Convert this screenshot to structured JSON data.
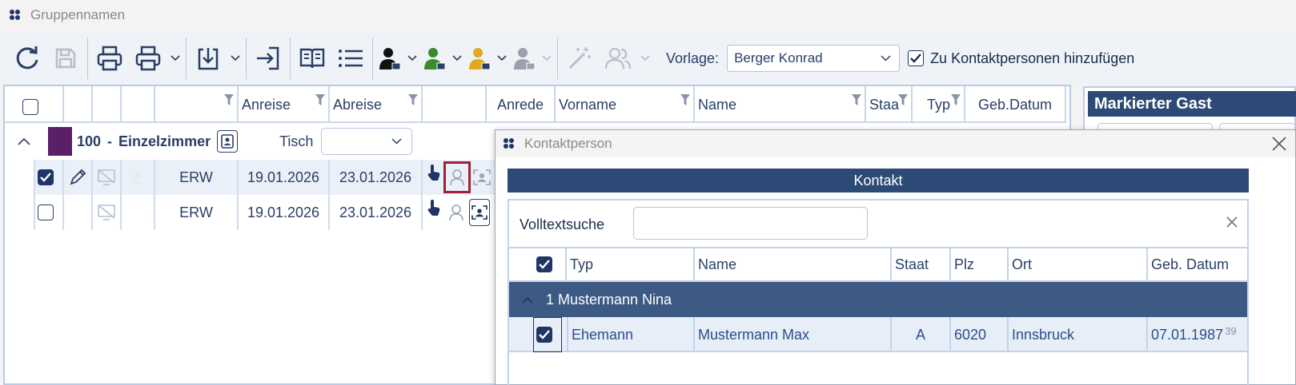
{
  "window": {
    "title": "Gruppennamen"
  },
  "toolbar": {
    "vorlage_label": "Vorlage:",
    "vorlage_value": "Berger Konrad",
    "add_contacts_label": "Zu Kontaktpersonen hinzufügen",
    "add_contacts_checked": true
  },
  "grid": {
    "headers": [
      "",
      "",
      "",
      "",
      "",
      "Anreise",
      "Abreise",
      "",
      "Anrede",
      "Vorname",
      "Name",
      "Staa",
      "Typ",
      "Geb.Datum"
    ],
    "group": {
      "room_number": "100",
      "separator": "-",
      "room_type": "Einzelzimmer",
      "table_label": "Tisch",
      "table_value": "",
      "color": "#5a1f66"
    },
    "rows": [
      {
        "selected": true,
        "type": "ERW",
        "arrival": "19.01.2026",
        "departure": "23.01.2026"
      },
      {
        "selected": false,
        "type": "ERW",
        "arrival": "19.01.2026",
        "departure": "23.01.2026"
      }
    ]
  },
  "right_panel": {
    "title": "Markierter Gast"
  },
  "dialog": {
    "title": "Kontaktperson",
    "section": "Kontakt",
    "search_label": "Volltextsuche",
    "search_value": "",
    "headers": [
      "Typ",
      "Name",
      "Staat",
      "Plz",
      "Ort",
      "Geb. Datum"
    ],
    "group_label": "1 Mustermann Nina",
    "rows": [
      {
        "checked": true,
        "typ": "Ehemann",
        "name": "Mustermann Max",
        "staat": "A",
        "plz": "6020",
        "ort": "Innsbruck",
        "geb_datum": "07.01.1987",
        "age": "39"
      }
    ]
  },
  "icons": [
    "refresh-icon",
    "save-icon",
    "print-icon",
    "print-icon-2",
    "import-icon",
    "export-icon",
    "book-icon",
    "list-icon",
    "person-black-icon",
    "person-green-icon",
    "person-yellow-icon",
    "person-gray-icon",
    "magic-wand-icon",
    "group-icon",
    "filter-icon",
    "pencil-icon",
    "no-screen-icon",
    "hand-pointer-icon",
    "person-outline-icon",
    "contact-card-icon",
    "close-icon",
    "chevron-down-icon",
    "chevron-up-icon"
  ],
  "colors": {
    "accent": "#2d4a76",
    "group_band": "#3d5a85",
    "highlight_border": "#a31f34"
  }
}
